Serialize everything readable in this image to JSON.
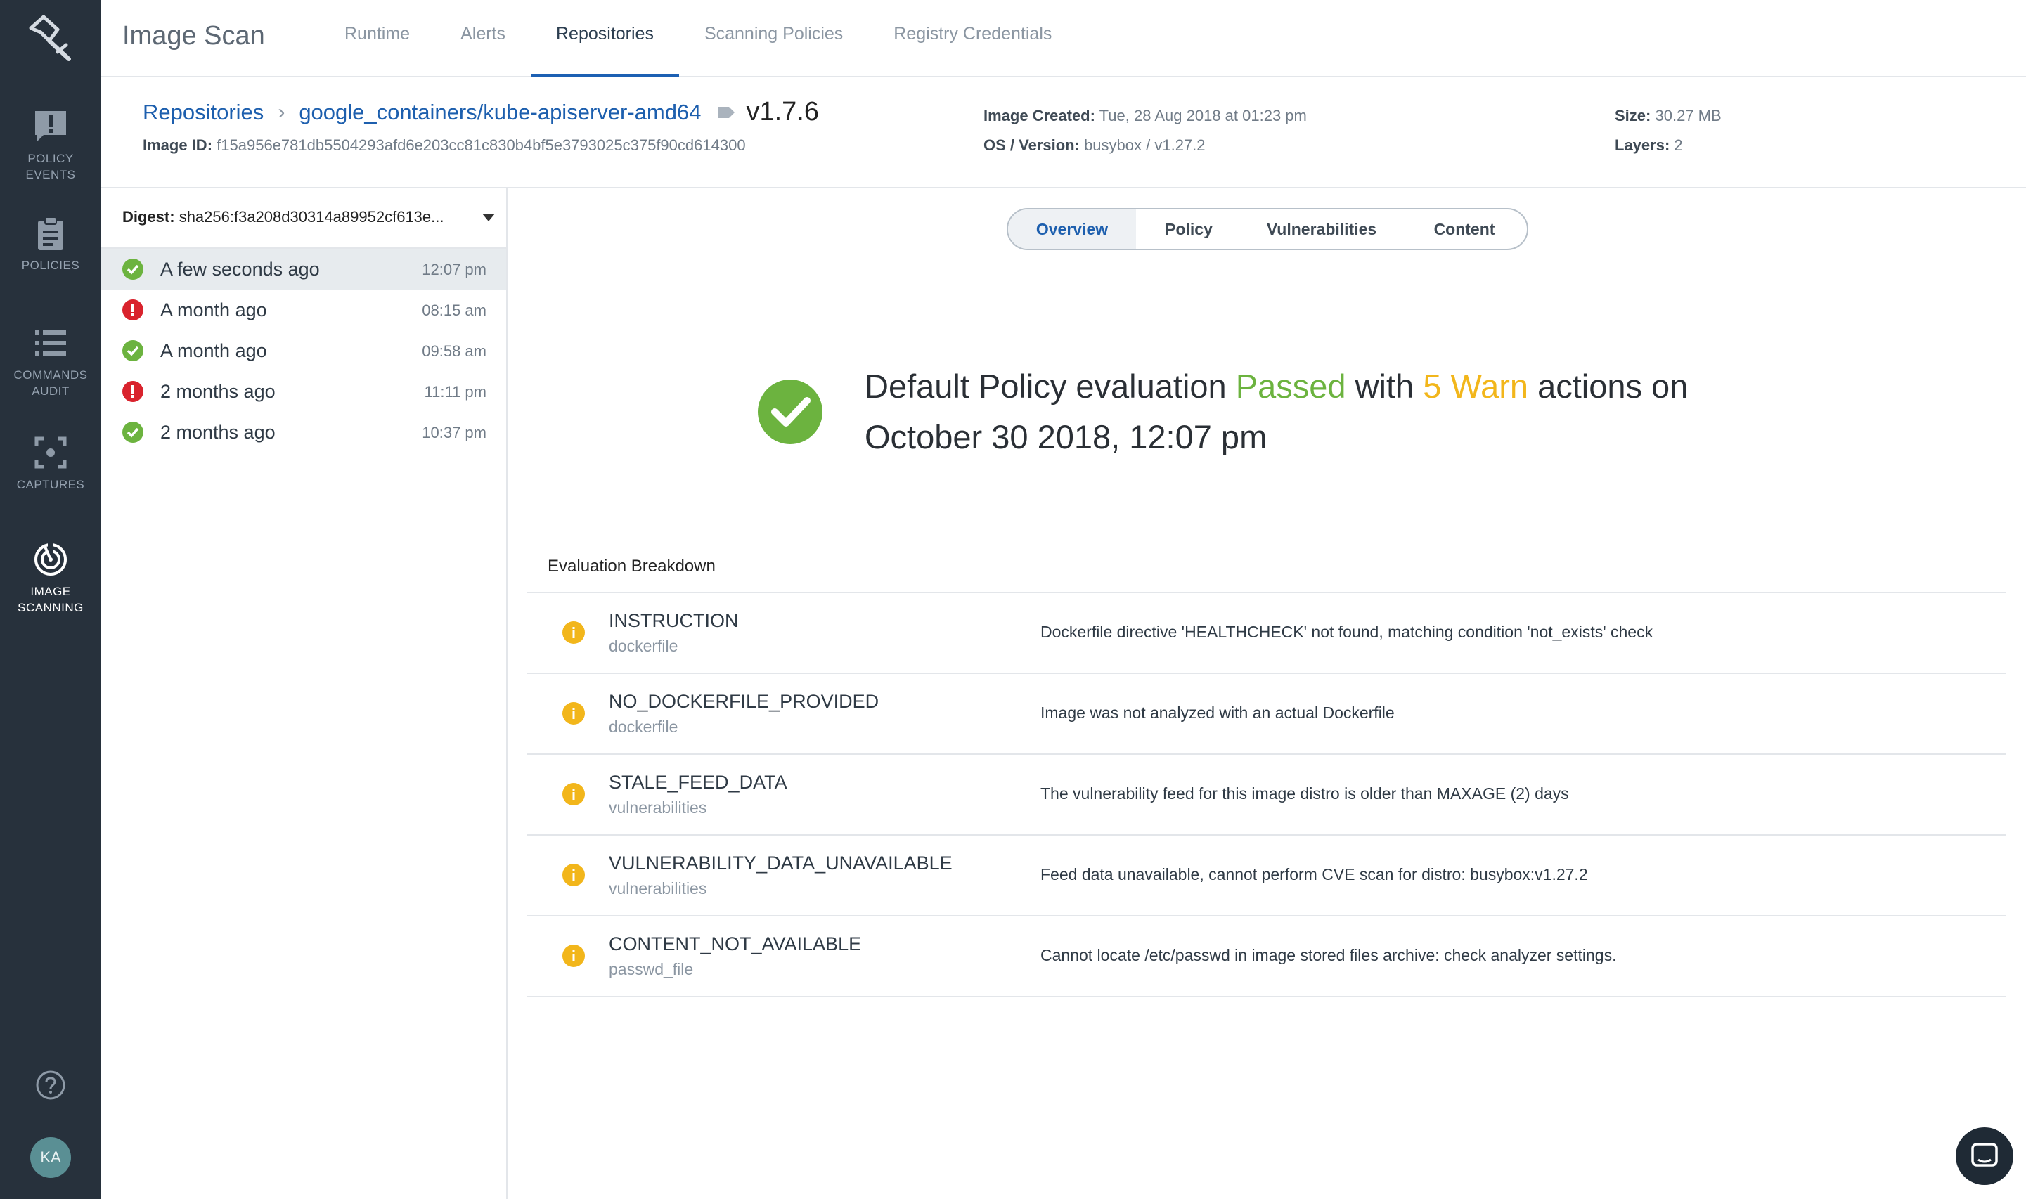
{
  "sidebar": {
    "items": [
      {
        "label_1": "POLICY",
        "label_2": "EVENTS"
      },
      {
        "label_1": "POLICIES",
        "label_2": ""
      },
      {
        "label_1": "COMMANDS",
        "label_2": "AUDIT"
      },
      {
        "label_1": "CAPTURES",
        "label_2": ""
      },
      {
        "label_1": "IMAGE",
        "label_2": "SCANNING"
      }
    ],
    "avatar_initials": "KA"
  },
  "topbar": {
    "title": "Image Scan",
    "tabs": [
      "Runtime",
      "Alerts",
      "Repositories",
      "Scanning Policies",
      "Registry Credentials"
    ],
    "active_tab": "Repositories"
  },
  "header": {
    "breadcrumb_root": "Repositories",
    "repository": "google_containers/kube-apiserver-amd64",
    "tag": "v1.7.6",
    "image_id_label": "Image ID:",
    "image_id": "f15a956e781db5504293afd6e203cc81c830b4bf5e3793025c375f90cd614300",
    "image_created_label": "Image Created:",
    "image_created": "Tue, 28 Aug 2018 at 01:23 pm",
    "os_label": "OS / Version:",
    "os": "busybox / v1.27.2",
    "size_label": "Size:",
    "size": "30.27 MB",
    "layers_label": "Layers:",
    "layers": "2"
  },
  "history": {
    "digest_label": "Digest:",
    "digest": "sha256:f3a208d30314a89952cf613e...",
    "rows": [
      {
        "when": "A few seconds ago",
        "time": "12:07 pm",
        "status": "pass"
      },
      {
        "when": "A month ago",
        "time": "08:15 am",
        "status": "fail"
      },
      {
        "when": "A month ago",
        "time": "09:58 am",
        "status": "pass"
      },
      {
        "when": "2 months ago",
        "time": "11:11 pm",
        "status": "fail"
      },
      {
        "when": "2 months ago",
        "time": "10:37 pm",
        "status": "pass"
      }
    ]
  },
  "main": {
    "segments": [
      "Overview",
      "Policy",
      "Vulnerabilities",
      "Content"
    ],
    "active_segment": "Overview",
    "result": {
      "prefix": "Default Policy evaluation",
      "status": "Passed",
      "with": "with",
      "warn": "5 Warn",
      "suffix": "actions on",
      "date": "October 30 2018, 12:07 pm"
    },
    "breakdown_title": "Evaluation Breakdown",
    "breakdown": [
      {
        "trigger": "INSTRUCTION",
        "gate": "dockerfile",
        "message": "Dockerfile directive 'HEALTHCHECK' not found, matching condition 'not_exists' check"
      },
      {
        "trigger": "NO_DOCKERFILE_PROVIDED",
        "gate": "dockerfile",
        "message": "Image was not analyzed with an actual Dockerfile"
      },
      {
        "trigger": "STALE_FEED_DATA",
        "gate": "vulnerabilities",
        "message": "The vulnerability feed for this image distro is older than MAXAGE (2) days"
      },
      {
        "trigger": "VULNERABILITY_DATA_UNAVAILABLE",
        "gate": "vulnerabilities",
        "message": "Feed data unavailable, cannot perform CVE scan for distro: busybox:v1.27.2"
      },
      {
        "trigger": "CONTENT_NOT_AVAILABLE",
        "gate": "passwd_file",
        "message": "Cannot locate /etc/passwd in image stored files archive: check analyzer settings."
      }
    ]
  },
  "colors": {
    "sidebar_bg": "#27313c",
    "link": "#1d5fae",
    "pass": "#6cb33f",
    "fail": "#d9232d",
    "warn": "#f2b61b"
  }
}
